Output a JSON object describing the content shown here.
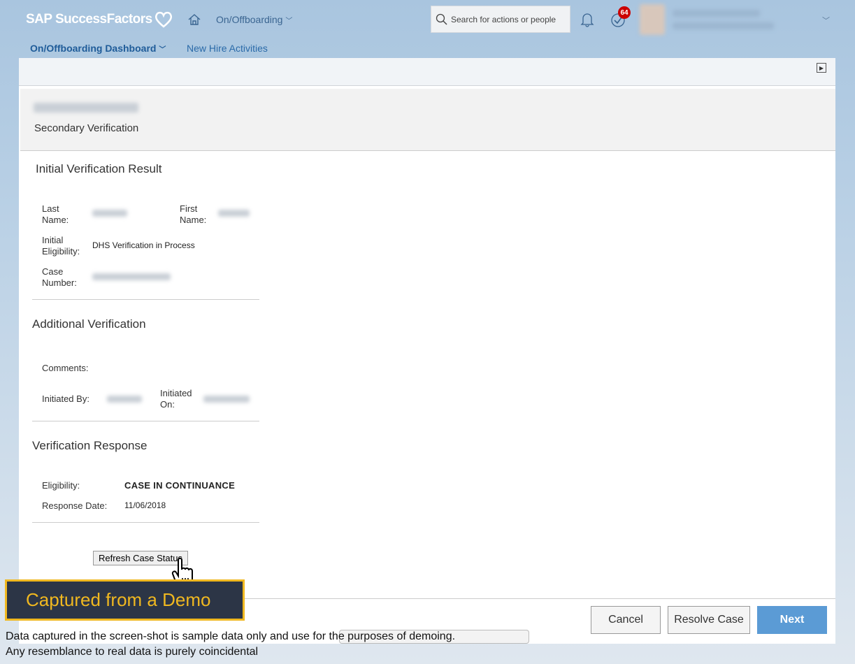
{
  "header": {
    "logo": "SAP SuccessFactors",
    "module": "On/Offboarding",
    "search_placeholder": "Search for actions or people",
    "todo_count": "64"
  },
  "subnav": {
    "dashboard": "On/Offboarding Dashboard",
    "new_hire": "New Hire Activities"
  },
  "page": {
    "subtitle": "Secondary Verification"
  },
  "initial": {
    "title": "Initial Verification Result",
    "last_name_label": "Last Name:",
    "first_name_label": "First Name:",
    "eligibility_label": "Initial Eligibility:",
    "eligibility_value": "DHS Verification in Process",
    "case_label": "Case Number:"
  },
  "additional": {
    "title": "Additional Verification",
    "comments_label": "Comments:",
    "initiated_by_label": "Initiated By:",
    "initiated_on_label": "Initiated On:"
  },
  "response": {
    "title": "Verification Response",
    "eligibility_label": "Eligibility:",
    "eligibility_value": "CASE IN CONTINUANCE",
    "date_label": "Response Date:",
    "date_value": "11/06/2018"
  },
  "buttons": {
    "refresh": "Refresh Case Status",
    "cancel": "Cancel",
    "resolve": "Resolve Case",
    "next": "Next"
  },
  "overlay": {
    "demo": "Captured from a Demo",
    "disclaimer1": "Data captured in the screen-shot is sample data only and use for the purposes of demoing.",
    "disclaimer2": "Any resemblance to real data is purely coincidental"
  },
  "colors": {
    "accent": "#5b9bd5",
    "badge": "#cc0000",
    "demo_border": "#f0b820"
  }
}
